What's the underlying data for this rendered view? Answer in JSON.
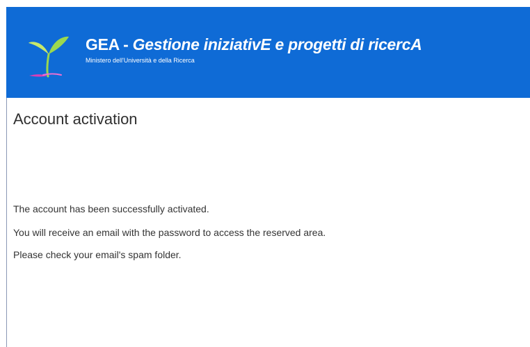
{
  "header": {
    "title_prefix": "GEA - ",
    "title_em": "Gestione iniziativE e progetti di ricercA",
    "subtitle": "Ministero dell'Università e della Ricerca",
    "background_color": "#0f6bd6",
    "logo_icon": "sprout-icon"
  },
  "main": {
    "page_title": "Account activation",
    "messages": [
      "The account has been successfully activated.",
      "You will receive an email with the password to access the reserved area.",
      "Please check your email's spam folder."
    ]
  }
}
